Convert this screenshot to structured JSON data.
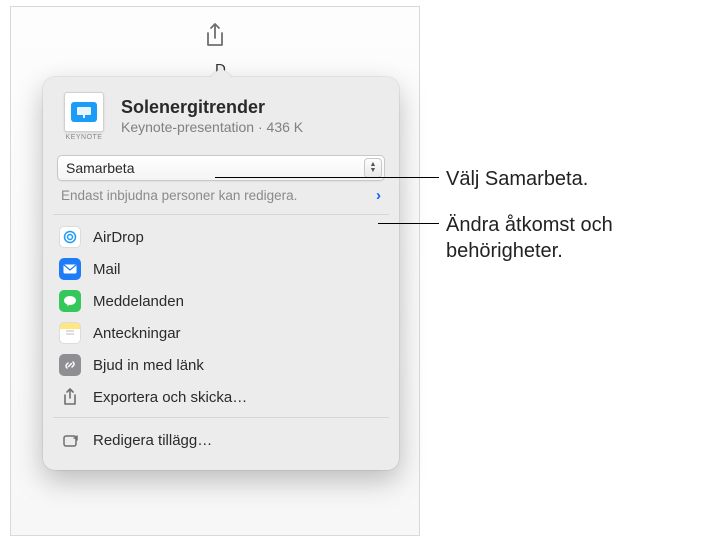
{
  "document": {
    "title": "Solenergitrender",
    "type": "Keynote-presentation",
    "size": "436 K",
    "thumb_label": "KEYNOTE"
  },
  "collab_select": {
    "value": "Samarbeta"
  },
  "permission": {
    "text": "Endast inbjudna personer kan redigera."
  },
  "share_options": [
    {
      "id": "airdrop",
      "label": "AirDrop"
    },
    {
      "id": "mail",
      "label": "Mail"
    },
    {
      "id": "messages",
      "label": "Meddelanden"
    },
    {
      "id": "notes",
      "label": "Anteckningar"
    },
    {
      "id": "invite-link",
      "label": "Bjud in med länk"
    },
    {
      "id": "export",
      "label": "Exportera och skicka…"
    }
  ],
  "footer": {
    "edit_extensions": "Redigera tillägg…"
  },
  "peek_letter": "D",
  "callouts": {
    "c1": "Välj Samarbeta.",
    "c2": "Ändra åtkomst och behörigheter."
  }
}
